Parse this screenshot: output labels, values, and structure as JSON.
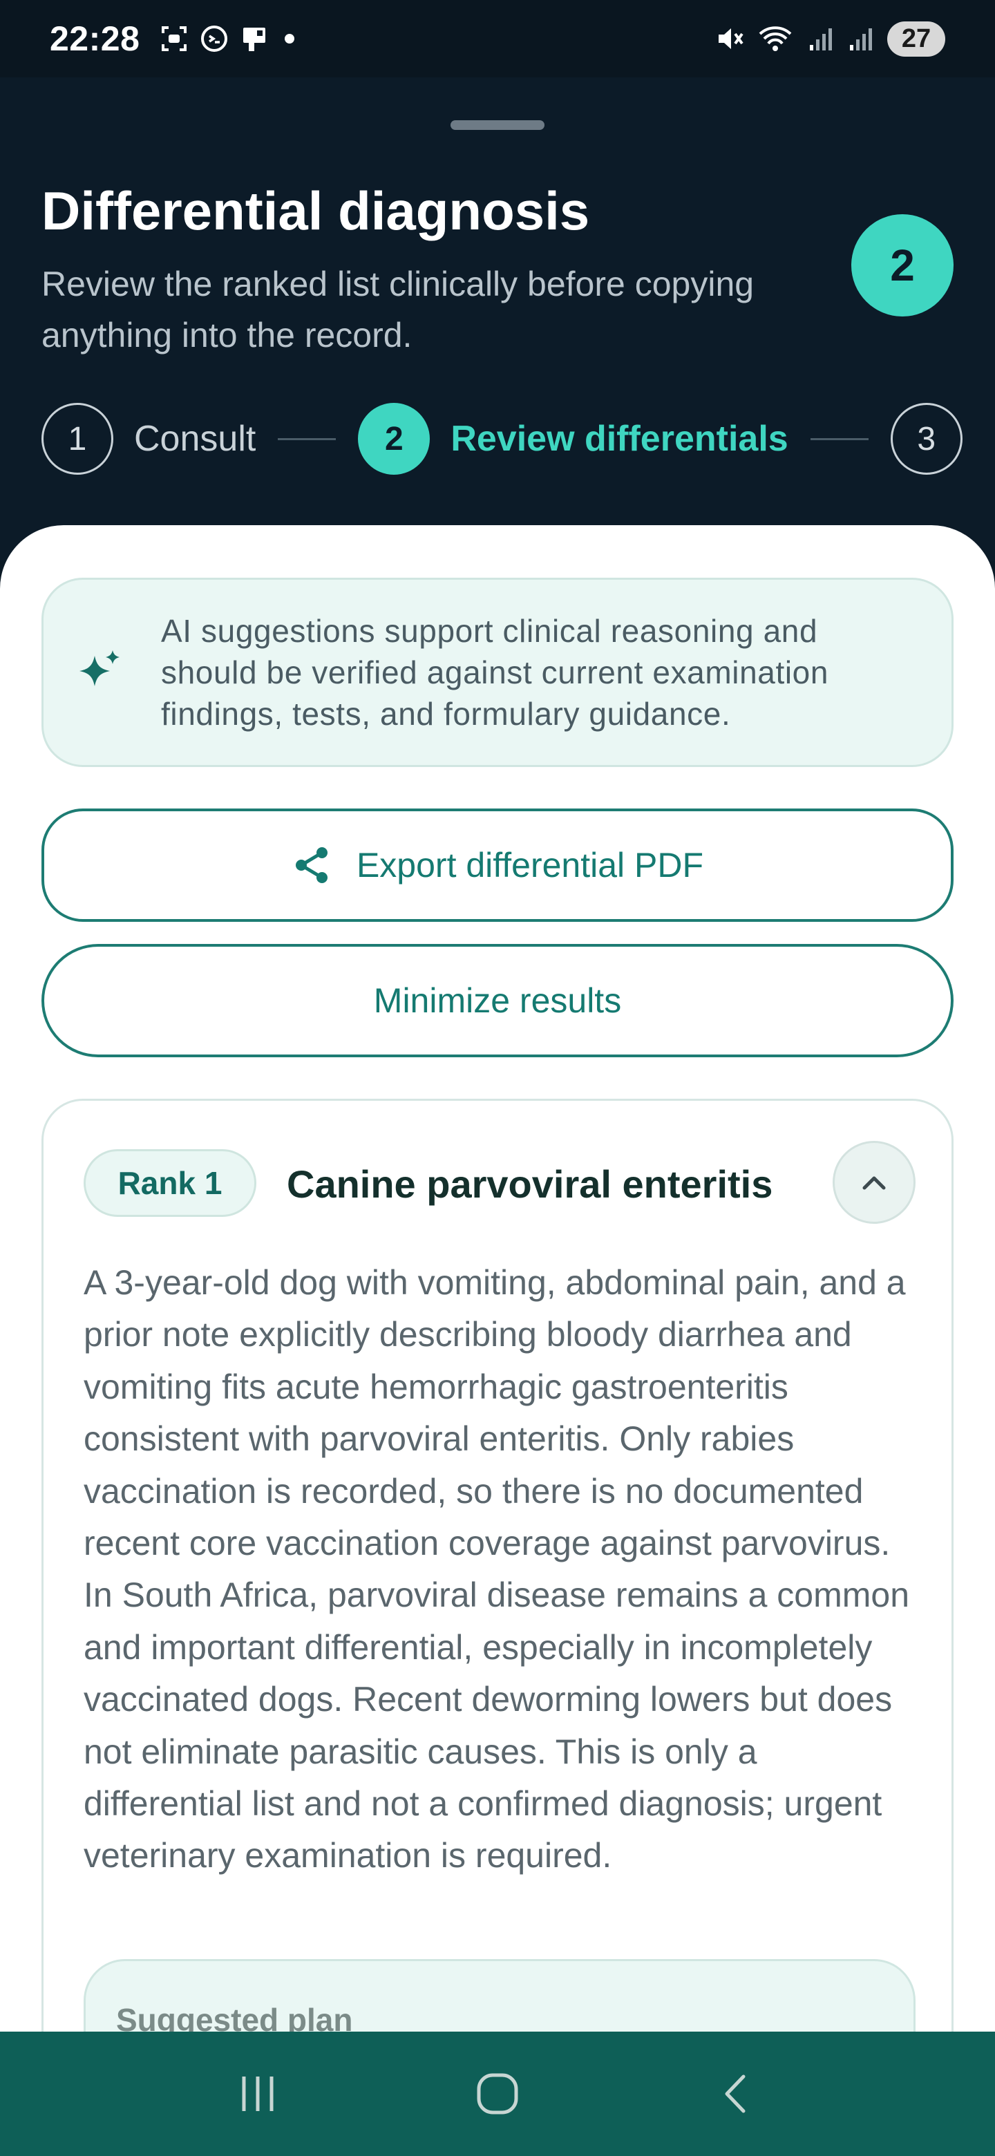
{
  "status_bar": {
    "time": "22:28",
    "left_icons": [
      "screenshot-icon",
      "chat-bubble-icon",
      "clipboard-icon",
      "dot-icon"
    ],
    "right_icons": [
      "mute-icon",
      "wifi-icon",
      "signal-icon",
      "signal-icon"
    ],
    "battery": "27"
  },
  "header": {
    "title": "Differential diagnosis",
    "subtitle": "Review the ranked list clinically before copying anything into the record.",
    "badge": "2",
    "steps": [
      {
        "number": "1",
        "label": "Consult",
        "state": "done"
      },
      {
        "number": "2",
        "label": "Review differentials",
        "state": "active"
      },
      {
        "number": "3",
        "label": "",
        "state": "upcoming"
      }
    ]
  },
  "notice": {
    "icon": "sparkle-icon",
    "text": "AI suggestions support clinical reasoning and should be verified against current examination findings, tests, and formulary guidance."
  },
  "actions": {
    "export_label": "Export differential PDF",
    "export_icon": "share-icon",
    "minimize_label": "Minimize results"
  },
  "results": [
    {
      "rank": "Rank 1",
      "title": "Canine parvoviral enteritis",
      "expanded": true,
      "description": "A 3-year-old dog with vomiting, abdominal pain, and a prior note explicitly describing bloody diarrhea and vomiting fits acute hemorrhagic gastroenteritis consistent with parvoviral enteritis. Only rabies vaccination is recorded, so there is no documented recent core vaccination coverage against parvovirus. In South Africa, parvoviral disease remains a common and important differential, especially in incompletely vaccinated dogs. Recent deworming lowers but does not eliminate parasitic causes. This is only a differential list and not a confirmed diagnosis; urgent veterinary examination is required.",
      "plan_label": "Suggested plan"
    }
  ],
  "colors": {
    "accent": "#3fd6c1",
    "header_bg": "#0c1b28",
    "primary_text": "#157a71",
    "navbar": "#0e5f57"
  }
}
